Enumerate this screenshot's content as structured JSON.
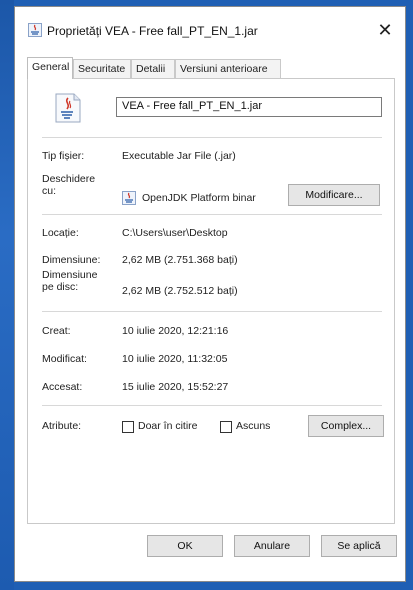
{
  "window": {
    "title": "Proprietăți VEA - Free fall_PT_EN_1.jar",
    "close": "✕"
  },
  "tabs": [
    {
      "label": "General"
    },
    {
      "label": "Securitate"
    },
    {
      "label": "Detalii"
    },
    {
      "label": "Versiuni anterioare"
    }
  ],
  "file": {
    "name": "VEA - Free fall_PT_EN_1.jar"
  },
  "props": {
    "type_label": "Tip fișier:",
    "type_value": "Executable Jar File (.jar)",
    "opens_label": "Deschidere cu:",
    "opens_value": "OpenJDK Platform binar",
    "change_button": "Modificare...",
    "location_label": "Locație:",
    "location_value": "C:\\Users\\user\\Desktop",
    "size_label": "Dimensiune:",
    "size_value": "2,62 MB (2.751.368 bați)",
    "disk_label": "Dimensiune pe disc:",
    "disk_value": "2,62 MB (2.752.512 bați)",
    "created_label": "Creat:",
    "created_value": "10 iulie 2020, 12:21:16",
    "modified_label": "Modificat:",
    "modified_value": "10 iulie 2020, 11:32:05",
    "accessed_label": "Accesat:",
    "accessed_value": "15 iulie 2020, 15:52:27",
    "attr_label": "Atribute:",
    "readonly_label": "Doar în citire",
    "hidden_label": "Ascuns",
    "advanced_button": "Complex..."
  },
  "footer": {
    "ok": "OK",
    "cancel": "Anulare",
    "apply": "Se aplică"
  },
  "colors": {
    "desktop": "#1f5fb4",
    "java_red": "#d0392b",
    "java_blue": "#2d5fa8"
  }
}
